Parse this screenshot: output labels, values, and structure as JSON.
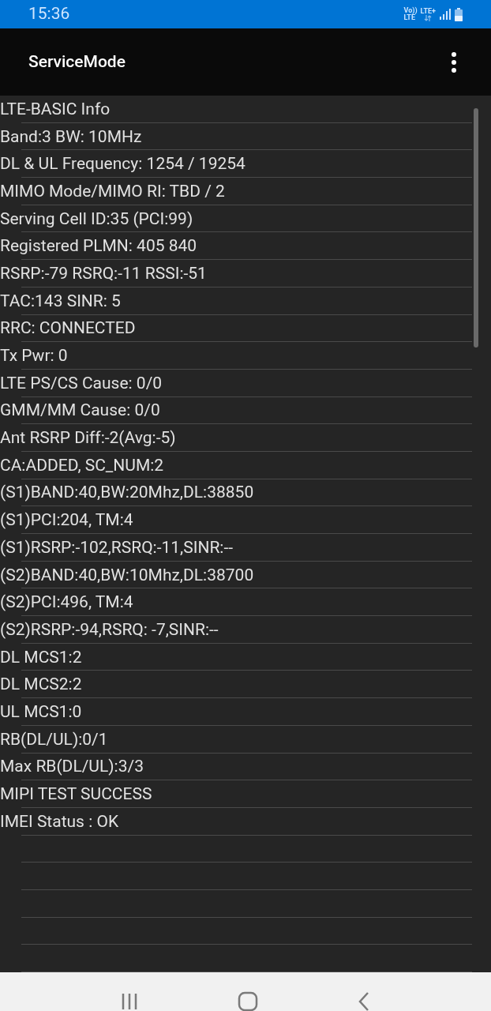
{
  "status_bar": {
    "time": "15:36",
    "volte_top": "Vo))",
    "volte_bottom": "LTE",
    "network": "LTE+"
  },
  "app_bar": {
    "title": "ServiceMode"
  },
  "lines": [
    "LTE-BASIC Info",
    "Band:3 BW: 10MHz",
    "DL & UL Frequency: 1254 / 19254",
    "MIMO Mode/MIMO RI: TBD / 2",
    "Serving Cell ID:35 (PCI:99)",
    "Registered PLMN: 405 840",
    "RSRP:-79 RSRQ:-11 RSSI:-51",
    "TAC:143 SINR: 5",
    "RRC: CONNECTED",
    "Tx Pwr: 0",
    "LTE PS/CS Cause: 0/0",
    "GMM/MM Cause: 0/0",
    "Ant RSRP Diff:-2(Avg:-5)",
    "CA:ADDED, SC_NUM:2",
    "(S1)BAND:40,BW:20Mhz,DL:38850",
    "(S1)PCI:204, TM:4",
    "(S1)RSRP:-102,RSRQ:-11,SINR:--",
    "(S2)BAND:40,BW:10Mhz,DL:38700",
    "(S2)PCI:496, TM:4",
    "(S2)RSRP:-94,RSRQ: -7,SINR:--",
    "DL MCS1:2",
    "DL MCS2:2",
    "UL MCS1:0",
    "RB(DL/UL):0/1",
    "Max RB(DL/UL):3/3",
    "MIPI TEST SUCCESS",
    "IMEI Status : OK"
  ]
}
